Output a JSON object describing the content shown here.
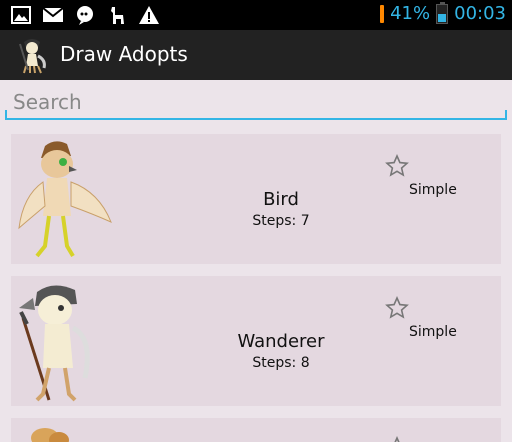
{
  "status_bar": {
    "battery_percent": "41%",
    "time": "00:03",
    "battery_level": 0.41,
    "accent_color": "#33b5e5",
    "icons": [
      "image-icon",
      "mail-icon",
      "notification-icon",
      "alpaca-icon",
      "warning-icon"
    ]
  },
  "action_bar": {
    "title": "Draw Adopts",
    "icon": "app-logo-icon"
  },
  "search": {
    "placeholder": "Search",
    "value": ""
  },
  "list": {
    "items": [
      {
        "name": "Bird",
        "steps": "Steps: 7",
        "difficulty": "Simple",
        "favorite": false,
        "image": "bird-character"
      },
      {
        "name": "Wanderer",
        "steps": "Steps: 8",
        "difficulty": "Simple",
        "favorite": false,
        "image": "wanderer-character"
      },
      {
        "name": "",
        "steps": "",
        "difficulty": "",
        "favorite": false,
        "image": "partial-character"
      }
    ]
  }
}
